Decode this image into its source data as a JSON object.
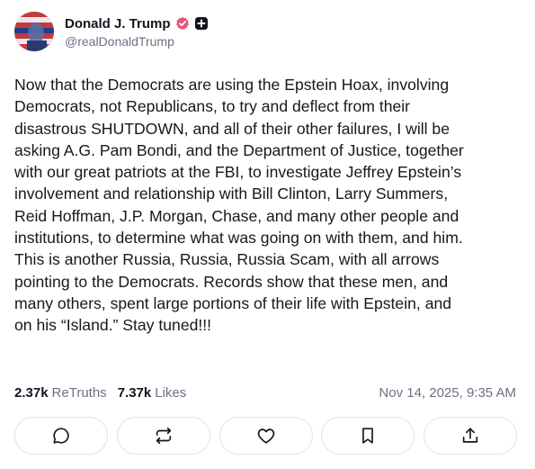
{
  "user": {
    "display_name": "Donald J. Trump",
    "handle": "@realDonaldTrump",
    "verified_badge": "verified-check-icon",
    "extra_badge": "plus-square-icon",
    "badge_color": "#e5527a"
  },
  "post": {
    "lines": [
      "Now that the Democrats are using the Epstein Hoax, involving",
      "Democrats, not Republicans, to try and deflect from their",
      "disastrous SHUTDOWN, and all of their other failures, I will be",
      "asking A.G. Pam Bondi, and the Department of Justice, together",
      "with our great patriots at the FBI, to investigate Jeffrey Epstein’s",
      "involvement and relationship with Bill Clinton, Larry Summers,",
      "Reid Hoffman, J.P. Morgan, Chase, and many other people and",
      "institutions, to determine what was going on with them, and him.",
      "This is another Russia, Russia, Russia Scam, with all arrows",
      "pointing to the Democrats. Records show that these men, and",
      "many others, spent large portions of their life with Epstein, and",
      "on his “Island.” Stay tuned!!!"
    ]
  },
  "stats": {
    "retruths_count": "2.37k",
    "retruths_label": "ReTruths",
    "likes_count": "7.37k",
    "likes_label": "Likes",
    "timestamp": "Nov 14, 2025, 9:35 AM"
  },
  "actions": [
    {
      "name": "reply",
      "icon": "comment-icon"
    },
    {
      "name": "retruth",
      "icon": "repost-icon"
    },
    {
      "name": "like",
      "icon": "heart-icon"
    },
    {
      "name": "bookmark",
      "icon": "bookmark-icon"
    },
    {
      "name": "share",
      "icon": "share-icon"
    }
  ],
  "colors": {
    "text": "#14141f",
    "muted": "#6f6f86",
    "border": "#e3e3ea",
    "badge": "#e5527a"
  }
}
